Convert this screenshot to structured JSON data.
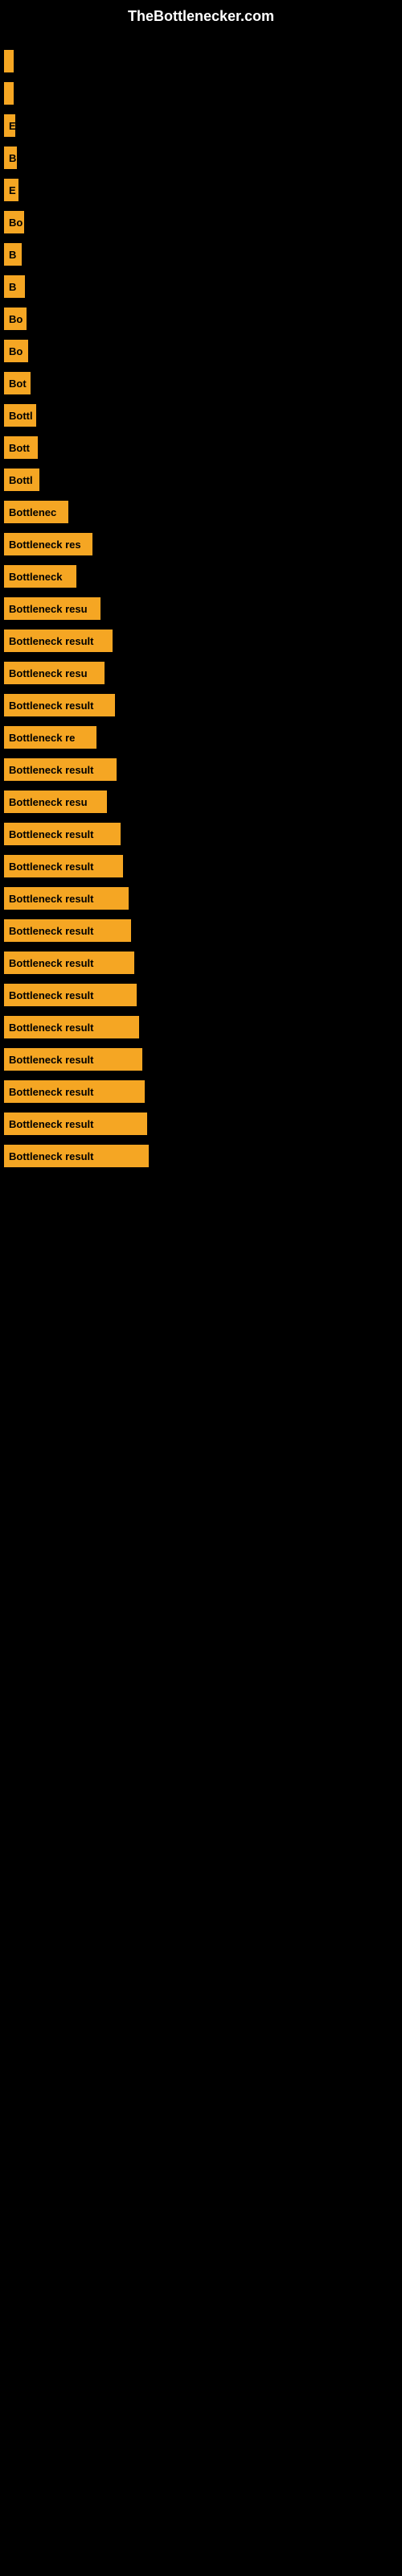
{
  "site": {
    "title": "TheBottlenecker.com"
  },
  "bars": [
    {
      "label": "",
      "width": 8
    },
    {
      "label": "",
      "width": 10
    },
    {
      "label": "E",
      "width": 14
    },
    {
      "label": "B",
      "width": 16
    },
    {
      "label": "E",
      "width": 18
    },
    {
      "label": "Bo",
      "width": 25
    },
    {
      "label": "B",
      "width": 22
    },
    {
      "label": "B",
      "width": 26
    },
    {
      "label": "Bo",
      "width": 28
    },
    {
      "label": "Bo",
      "width": 30
    },
    {
      "label": "Bot",
      "width": 33
    },
    {
      "label": "Bottl",
      "width": 40
    },
    {
      "label": "Bott",
      "width": 42
    },
    {
      "label": "Bottl",
      "width": 44
    },
    {
      "label": "Bottlenec",
      "width": 80
    },
    {
      "label": "Bottleneck res",
      "width": 110
    },
    {
      "label": "Bottleneck",
      "width": 90
    },
    {
      "label": "Bottleneck resu",
      "width": 120
    },
    {
      "label": "Bottleneck result",
      "width": 135
    },
    {
      "label": "Bottleneck resu",
      "width": 125
    },
    {
      "label": "Bottleneck result",
      "width": 138
    },
    {
      "label": "Bottleneck re",
      "width": 115
    },
    {
      "label": "Bottleneck result",
      "width": 140
    },
    {
      "label": "Bottleneck resu",
      "width": 128
    },
    {
      "label": "Bottleneck result",
      "width": 145
    },
    {
      "label": "Bottleneck result",
      "width": 148
    },
    {
      "label": "Bottleneck result",
      "width": 155
    },
    {
      "label": "Bottleneck result",
      "width": 158
    },
    {
      "label": "Bottleneck result",
      "width": 162
    },
    {
      "label": "Bottleneck result",
      "width": 165
    },
    {
      "label": "Bottleneck result",
      "width": 168
    },
    {
      "label": "Bottleneck result",
      "width": 172
    },
    {
      "label": "Bottleneck result",
      "width": 175
    },
    {
      "label": "Bottleneck result",
      "width": 178
    },
    {
      "label": "Bottleneck result",
      "width": 180
    }
  ]
}
